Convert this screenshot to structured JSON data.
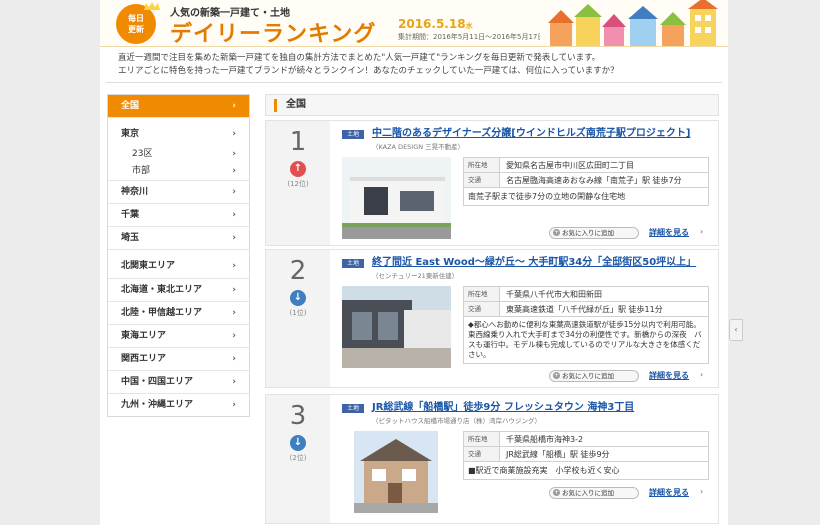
{
  "header": {
    "badge_line1": "毎日",
    "badge_line2": "更新",
    "subtitle": "人気の新築一戸建て・土地",
    "title": "デイリーランキング",
    "date": "2016.5.18",
    "date_day": "水",
    "period": "集計期間：2016年5月11日〜2016年5月17日"
  },
  "intro": {
    "line1": "直近一週間で注目を集めた新築一戸建てを独自の集計方法でまとめた\"人気一戸建て\"ランキングを毎日更新で発表しています。",
    "line2": "エリアごとに特色を持った一戸建てブランドが続々とランクイン！あなたのチェックしていた一戸建ては、何位に入っていますか？"
  },
  "sidebar": {
    "all": "全国",
    "items": [
      {
        "label": "東京",
        "kind": "main"
      },
      {
        "label": "23区",
        "kind": "sub"
      },
      {
        "label": "市部",
        "kind": "sub"
      },
      {
        "label": "神奈川",
        "kind": "main"
      },
      {
        "label": "千葉",
        "kind": "main"
      },
      {
        "label": "埼玉",
        "kind": "main"
      },
      {
        "label": "北関東エリア",
        "kind": "main"
      },
      {
        "label": "北海道・東北エリア",
        "kind": "main"
      },
      {
        "label": "北陸・甲信越エリア",
        "kind": "main"
      },
      {
        "label": "東海エリア",
        "kind": "main"
      },
      {
        "label": "関西エリア",
        "kind": "main"
      },
      {
        "label": "中国・四国エリア",
        "kind": "main"
      },
      {
        "label": "九州・沖縄エリア",
        "kind": "main"
      }
    ],
    "chevron": "›"
  },
  "main": {
    "heading": "全国",
    "info_keys": {
      "location": "所在地",
      "transport": "交通"
    },
    "fav_label": "お気に入りに追加",
    "detail_label": "詳細を見る",
    "entries": [
      {
        "rank": "1",
        "trend": "up",
        "prev_rank": "(12位)",
        "tag": "土地",
        "title": "中二階のあるデザイナーズ分譲[ウインドヒルズ南荒子駅プロジェクト]",
        "maker": "（KAZA DESIGN 三晃不動産）",
        "location": "愛知県名古屋市中川区広田町二丁目",
        "transport": "名古屋臨海高速あおなみ線「南荒子」駅 徒歩7分",
        "desc": "南荒子駅まで徒歩7分の立地の閑静な住宅地"
      },
      {
        "rank": "2",
        "trend": "down",
        "prev_rank": "(1位)",
        "tag": "土地",
        "title": "終了間近 East Wood〜緑が丘〜 大手町駅34分「全邸街区50坪以上」",
        "maker": "（センチュリー21東新住建）",
        "location": "千葉県八千代市大和田新田",
        "transport": "東葉高速鉄道「八千代緑が丘」駅 徒歩11分",
        "desc": "◆都心へお勤めに便利な東葉高速鉄道駅が徒歩15分以内で利用可能。東西線乗り入れで大手町まで34分の利便性です。新橋からの深夜　バスも運行中。モデル棟も完成しているのでリアルな大きさを体感ください。"
      },
      {
        "rank": "3",
        "trend": "down",
        "prev_rank": "(2位)",
        "tag": "土地",
        "title": "JR総武線「船橋駅」徒歩9分 フレッシュタウン 海神3丁目",
        "maker": "（ピタットハウス船橋市場通り店（株）湾岸ハウジング）",
        "location": "千葉県船橋市海神3-2",
        "transport": "JR総武線「船橋」駅 徒歩9分",
        "desc": "■駅近で商業施設充実　小学校も近く安心"
      }
    ]
  },
  "icons": {
    "up": "↑",
    "down": "↓",
    "plus": "+",
    "detail_chev": "›",
    "scroll": "‹"
  },
  "colors": {
    "accent": "#f08a00",
    "link": "#1a55a8",
    "tag": "#3f62a5",
    "up": "#e05050",
    "down": "#3f7fc0"
  }
}
